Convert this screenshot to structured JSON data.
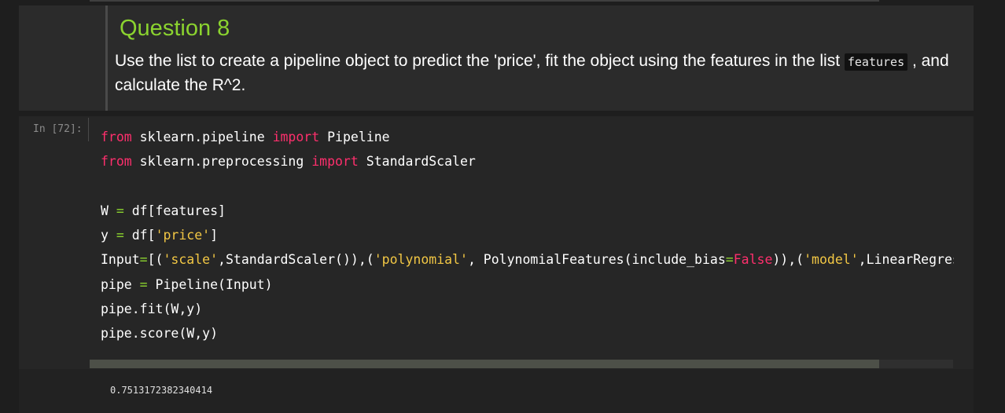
{
  "markdown": {
    "title": "Question 8",
    "text_before": "Use the list to create a pipeline object to predict the 'price', fit the object using the features in the list ",
    "code_inline": "features",
    "text_after": " , and calculate the R^2."
  },
  "code_cell": {
    "prompt": "In [72]:",
    "lines": [
      [
        [
          "from",
          "kw"
        ],
        [
          " sklearn.pipeline ",
          ""
        ],
        [
          "import",
          "kw"
        ],
        [
          " Pipeline",
          ""
        ]
      ],
      [
        [
          "from",
          "kw"
        ],
        [
          " sklearn.preprocessing ",
          ""
        ],
        [
          "import",
          "kw"
        ],
        [
          " StandardScaler",
          ""
        ]
      ],
      [],
      [
        [
          "W ",
          ""
        ],
        [
          "=",
          "op"
        ],
        [
          " df[features]",
          ""
        ]
      ],
      [
        [
          "y ",
          ""
        ],
        [
          "=",
          "op"
        ],
        [
          " df[",
          ""
        ],
        [
          "'price'",
          "str"
        ],
        [
          "]",
          ""
        ]
      ],
      [
        [
          "Input",
          ""
        ],
        [
          "=",
          "op"
        ],
        [
          "[(",
          ""
        ],
        [
          "'scale'",
          "str"
        ],
        [
          ",StandardScaler()),(",
          ""
        ],
        [
          "'polynomial'",
          "str"
        ],
        [
          ", PolynomialFeatures(include_bias",
          ""
        ],
        [
          "=",
          "op"
        ],
        [
          "False",
          "kw"
        ],
        [
          ")),(",
          ""
        ],
        [
          "'model'",
          "str"
        ],
        [
          ",LinearRegression())]",
          ""
        ]
      ],
      [
        [
          "pipe ",
          ""
        ],
        [
          "=",
          "op"
        ],
        [
          " Pipeline(Input)",
          ""
        ]
      ],
      [
        [
          "pipe.fit(W,y)",
          ""
        ]
      ],
      [
        [
          "pipe.score(W,y)",
          ""
        ]
      ]
    ]
  },
  "output": {
    "text": "0.7513172382340414"
  },
  "colors": {
    "keyword": "#ff2f6d",
    "string": "#f2c744",
    "operator": "#8bd32f",
    "title": "#8bd32f"
  }
}
